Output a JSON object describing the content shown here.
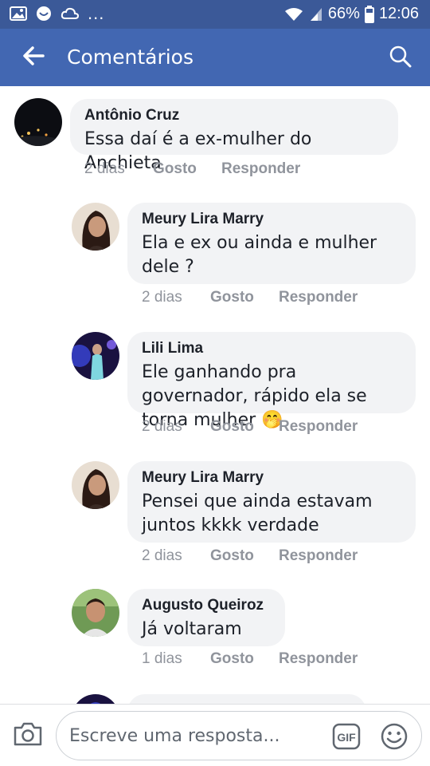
{
  "status_bar": {
    "battery": "66%",
    "time": "12:06",
    "icons": [
      "gallery-icon",
      "smiley-notification-icon",
      "cloud-icon",
      "wifi-icon",
      "signal-icon",
      "battery-icon"
    ],
    "overflow": "..."
  },
  "app_bar": {
    "title": "Comentários",
    "back_icon": "back-arrow-icon",
    "search_icon": "search-icon"
  },
  "comments": [
    {
      "author": "Antônio Cruz",
      "text": "Essa daí é a ex-mulher do Anchieta",
      "time": "2 dias",
      "like": "Gosto",
      "reply": "Responder",
      "reply_level": 0
    },
    {
      "author": "Meury Lira Marry",
      "text": "Ela e ex ou ainda e mulher dele ?",
      "time": "2 dias",
      "like": "Gosto",
      "reply": "Responder",
      "reply_level": 1
    },
    {
      "author": "Lili Lima",
      "text": "Ele ganhando pra governador, rápido ela se torna mulher",
      "emoji": "🤭",
      "time": "2 dias",
      "like": "Gosto",
      "reply": "Responder",
      "reply_level": 1
    },
    {
      "author": "Meury Lira Marry",
      "text": "Pensei que ainda estavam juntos kkkk verdade",
      "time": "2 dias",
      "like": "Gosto",
      "reply": "Responder",
      "reply_level": 1
    },
    {
      "author": "Augusto Queiroz",
      "text": "Já voltaram",
      "time": "1 dias",
      "like": "Gosto",
      "reply": "Responder",
      "reply_level": 1
    }
  ],
  "composer": {
    "placeholder": "Escreve uma resposta...",
    "camera_icon": "camera-icon",
    "gif_label": "GIF",
    "emoji_icon": "emoji-icon"
  },
  "colors": {
    "status_bar": "#3b5998",
    "app_bar": "#4267b2",
    "bubble": "#f2f3f5",
    "meta_text": "#90949c"
  }
}
